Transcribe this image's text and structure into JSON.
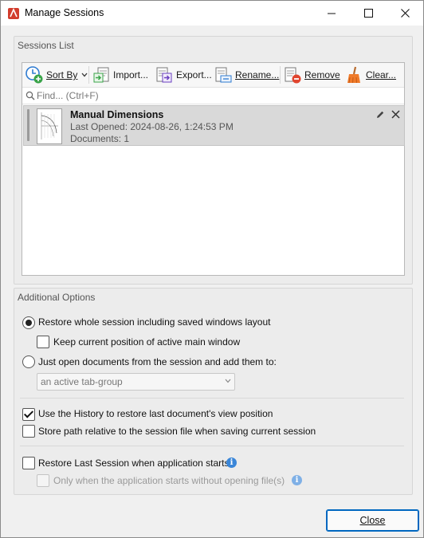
{
  "window": {
    "title": "Manage Sessions"
  },
  "sessions_group": {
    "title": "Sessions List",
    "toolbar": {
      "sort_by": "Sort By",
      "import": "Import...",
      "export": "Export...",
      "rename": "Rename...",
      "remove": "Remove",
      "clear": "Clear..."
    },
    "find_placeholder": "Find... (Ctrl+F)",
    "sessions": [
      {
        "name": "Manual Dimensions",
        "last_opened": "Last Opened: 2024-08-26, 1:24:53 PM",
        "documents": "Documents: 1"
      }
    ]
  },
  "options_group": {
    "title": "Additional Options",
    "restore_whole": {
      "label": "Restore whole session including saved windows layout",
      "checked": true
    },
    "keep_position": {
      "label": "Keep current position of active main window",
      "checked": false
    },
    "just_open": {
      "label": "Just open documents from the session and add them to:",
      "checked": false
    },
    "target_select": {
      "value": "an active tab-group"
    },
    "use_history": {
      "label": "Use the History to restore last document's view position",
      "checked": true
    },
    "store_relative": {
      "label": "Store path relative to the session file when saving current session",
      "checked": false
    },
    "restore_last": {
      "label": "Restore Last Session when application starts",
      "checked": false
    },
    "only_when": {
      "label": "Only when the application starts without opening file(s)",
      "checked": false,
      "disabled": true
    }
  },
  "footer": {
    "close": "Close"
  },
  "colors": {
    "accent": "#0067c0",
    "selected_row": "#d9d9d9",
    "info": "#3a86d8"
  }
}
